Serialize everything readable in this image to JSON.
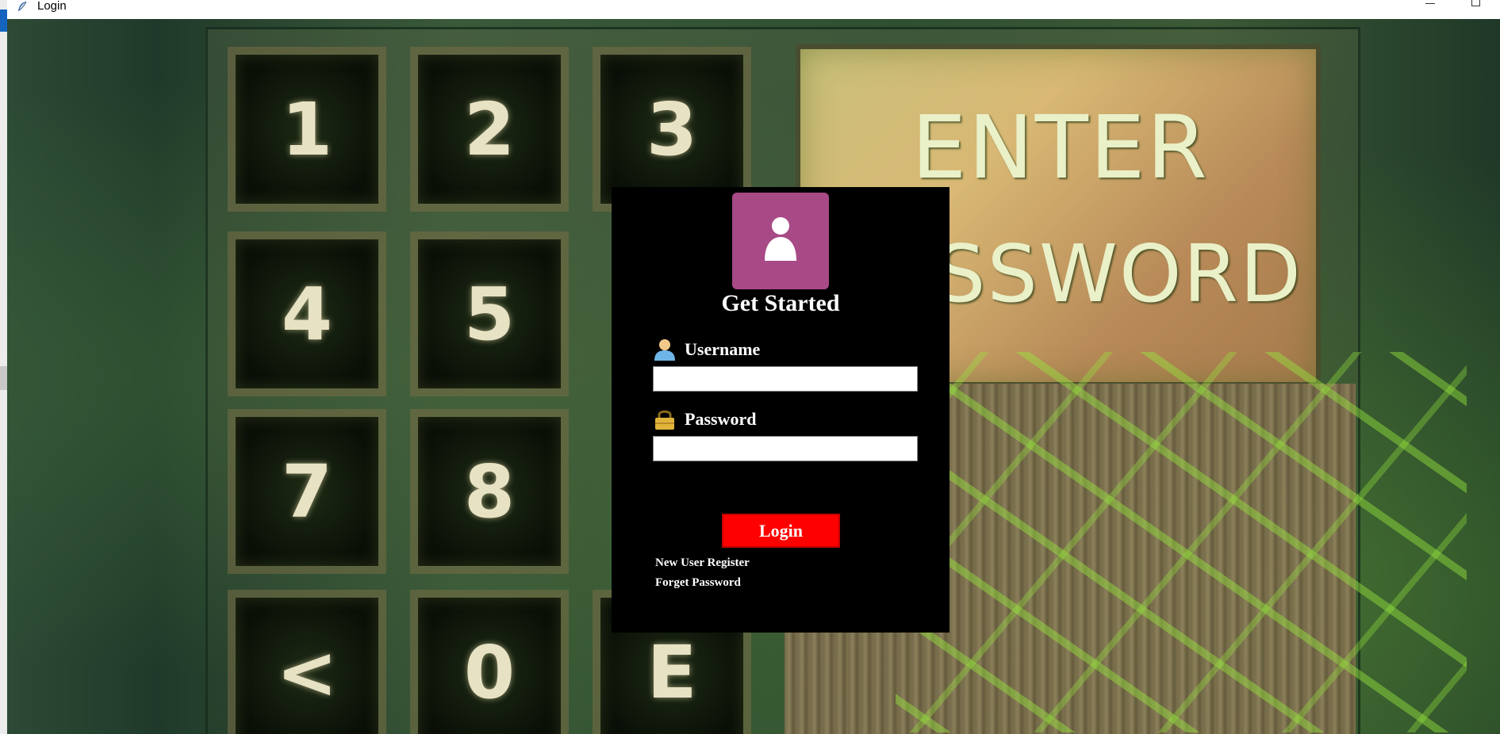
{
  "window": {
    "title": "Login",
    "app_icon": "feather-icon"
  },
  "background": {
    "keypad_keys": [
      "1",
      "2",
      "3",
      "4",
      "5",
      "7",
      "8",
      "<",
      "0",
      "E"
    ],
    "sign_words": [
      "ENTER",
      "SSWORD"
    ]
  },
  "login": {
    "avatar_icon": "user-icon",
    "title": "Get Started",
    "username_label": "Username",
    "username_value": "",
    "password_label": "Password",
    "password_value": "",
    "login_button": "Login",
    "register_link": "New User Register",
    "forgot_link": "Forget Password"
  },
  "colors": {
    "card_bg": "#000000",
    "avatar_bg": "#a84a86",
    "login_button_bg": "#ff0000",
    "text": "#ffffff"
  }
}
